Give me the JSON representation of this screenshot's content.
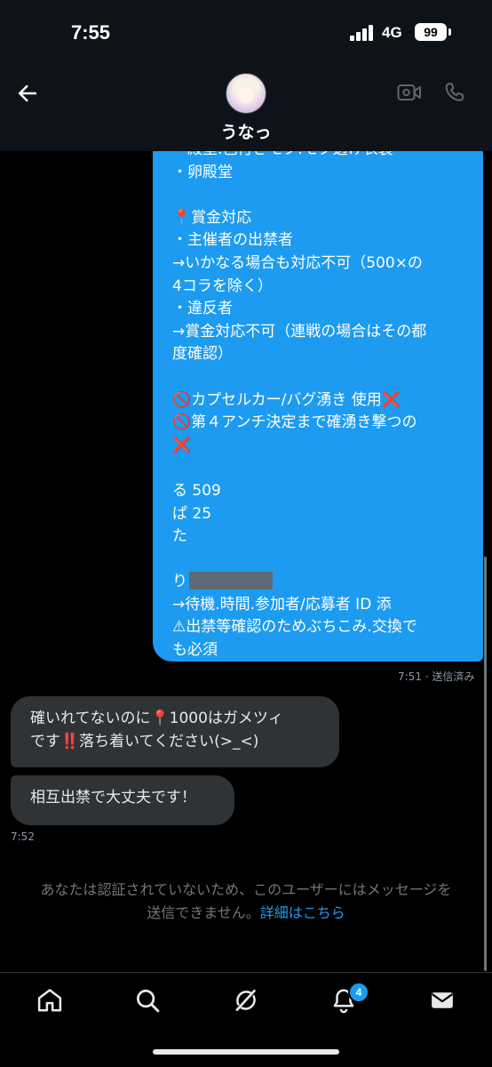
{
  "status_bar": {
    "time": "7:55",
    "network": "4G",
    "battery": "99"
  },
  "header": {
    "contact_name": "うなっ",
    "icons": [
      "back-arrow-icon",
      "avatar",
      "video-camera-icon",
      "phone-icon"
    ]
  },
  "messages": {
    "sent": {
      "lines": [
        "・殿堂.色付きモク.モク透け衣装",
        "・卵殿堂",
        "",
        "📍賞金対応",
        "・主催者の出禁者",
        "→いかなる場合も対応不可（500×の",
        "4コラを除く）",
        "・違反者",
        "→賞金対応不可（連戦の場合はその都",
        "度確認）",
        "",
        "🚫カプセルカー/バグ湧き 使用",
        "🚫第４アンチ決定まで確湧き撃つの",
        "",
        "",
        "る 509",
        "ぱ 25",
        "た",
        "",
        "り",
        "→待機.時間.参加者/応募者 ID 添",
        "⚠出禁等確認のためぶちこみ.交換で",
        "も必須"
      ],
      "x_mark": "❌",
      "meta": "7:51 · 送信済み"
    },
    "received": [
      {
        "lines": [
          "確いれてないのに📍1000はガメツィ",
          "です‼️落ち着いてください(>_<)"
        ]
      },
      {
        "lines": [
          "相互出禁で大丈夫です！"
        ]
      }
    ],
    "received_time": "7:52"
  },
  "notice": {
    "line1": "あなたは認証されていないため、このユーザーにはメッセージを",
    "line2": "送信できません。",
    "link": "詳細はこちら"
  },
  "bottom_nav": {
    "items": [
      "home-icon",
      "search-icon",
      "grok-icon",
      "notifications-icon",
      "messages-icon"
    ],
    "notification_badge": "4"
  },
  "colors": {
    "accent": "#1d9bf0",
    "background": "#000000",
    "received_bubble": "#2f3336",
    "x_mark": "#e0245e"
  }
}
